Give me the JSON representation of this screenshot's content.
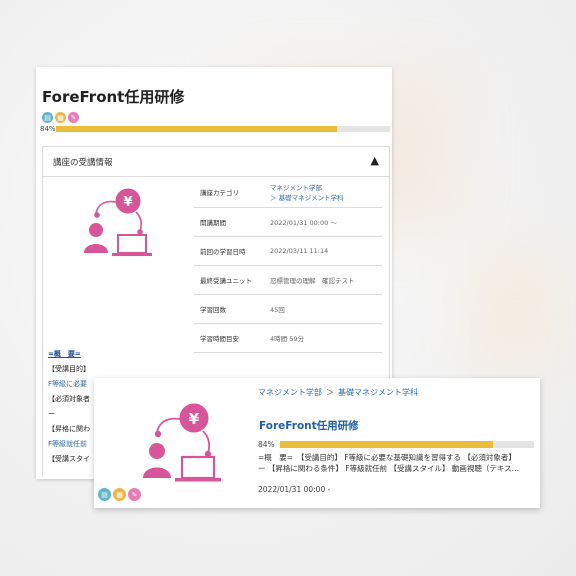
{
  "back_card": {
    "title": "ForeFront任用研修",
    "icons": [
      "book-icon",
      "document-icon",
      "pen-icon"
    ],
    "progress": {
      "label": "84%",
      "value": 84
    },
    "accordion": {
      "header": "講座の受講情報",
      "caret": "▲"
    },
    "info": [
      {
        "key": "講座カテゴリ",
        "value": "マネジメント学部",
        "value2": "＞ 基礎マネジメント学科"
      },
      {
        "key": "開講期間",
        "value": "2022/01/31 00:00 〜"
      },
      {
        "key": "前回の学習日時",
        "value": "2022/03/11 11:14"
      },
      {
        "key": "最終受講ユニット",
        "value": "忍標管理の理解　確認テスト"
      },
      {
        "key": "学習回数",
        "value": "45回"
      },
      {
        "key": "学習時間目安",
        "value": "4時間 59分"
      }
    ],
    "overview": {
      "title": "=概　要=",
      "lines": [
        "【受講目的】",
        "F等級に必要",
        "【必須対象者",
        "ー",
        "【昇格に関わ",
        "F等級就任前",
        "【受講スタイ"
      ]
    }
  },
  "front_card": {
    "breadcrumb": [
      "マネジメント学部",
      "基礎マネジメント学科"
    ],
    "breadcrumb_sep": "＞",
    "title": "ForeFront任用研修",
    "progress": {
      "label": "84%",
      "value": 84
    },
    "desc_line1": "=概　要=　【受講目的】 F等級に必要な基礎知識を習得する 【必須対象者】",
    "desc_line2": "ー 【昇格に関わる条件】 F等級就任前 【受講スタイル】 動画視聴（テキス…",
    "date": "2022/01/31 00:00 -",
    "icons": [
      "book-icon",
      "document-icon",
      "pen-icon"
    ]
  },
  "colors": {
    "accent": "#e8bd3a",
    "illustration": "#d9559a",
    "link": "#2e6fb0"
  }
}
